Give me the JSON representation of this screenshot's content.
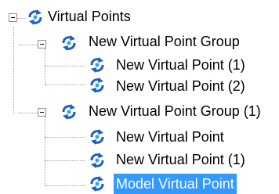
{
  "tree": {
    "root": {
      "label": "Virtual Points",
      "expanded": true
    },
    "groups": [
      {
        "label": "New Virtual Point Group",
        "expanded": true,
        "items": [
          {
            "label": "New Virtual Point (1)"
          },
          {
            "label": "New Virtual Point (2)"
          }
        ]
      },
      {
        "label": "New Virtual Point Group (1)",
        "expanded": true,
        "items": [
          {
            "label": "New Virtual Point"
          },
          {
            "label": "New Virtual Point (1)"
          },
          {
            "label": "Model Virtual Point",
            "selected": true
          }
        ]
      }
    ]
  },
  "colors": {
    "selection": "#3399ff",
    "icon_blue": "#1f5fbf",
    "icon_cyan": "#2aa7e0"
  },
  "icons": {
    "node": "virtual-point-icon",
    "expander": "collapse-minus-icon"
  }
}
